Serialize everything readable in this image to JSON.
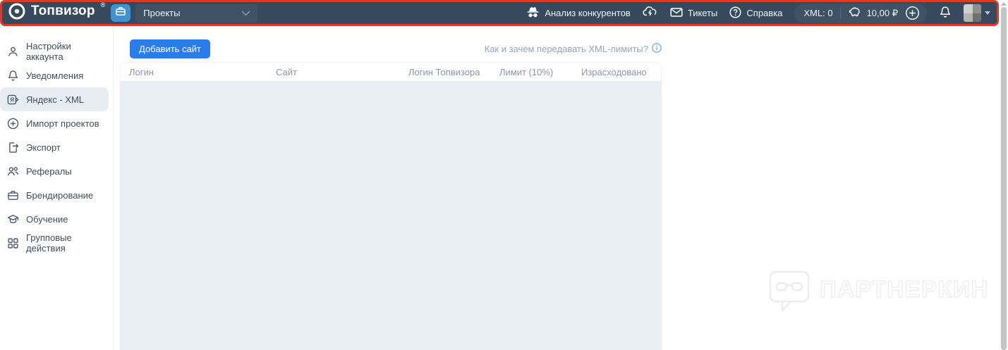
{
  "header": {
    "logo_text": "Топвизор",
    "logo_reg": "®",
    "projects_dropdown": "Проекты",
    "nav": {
      "competitors_label": "Анализ конкурентов",
      "tickets_label": "Тикеты",
      "help_label": "Справка"
    },
    "xml_limit": "XML: 0",
    "balance": "10,00 ₽"
  },
  "sidebar": {
    "items": [
      {
        "label": "Настройки аккаунта",
        "icon": "user-icon",
        "active": false
      },
      {
        "label": "Уведомления",
        "icon": "bell-icon",
        "active": false
      },
      {
        "label": "Яндекс - XML",
        "icon": "yandex-xml-icon",
        "active": true
      },
      {
        "label": "Импорт проектов",
        "icon": "plus-circle-icon",
        "active": false
      },
      {
        "label": "Экспорт",
        "icon": "export-icon",
        "active": false
      },
      {
        "label": "Рефералы",
        "icon": "referrals-icon",
        "active": false
      },
      {
        "label": "Брендирование",
        "icon": "briefcase-icon",
        "active": false
      },
      {
        "label": "Обучение",
        "icon": "graduation-cap-icon",
        "active": false
      },
      {
        "label": "Групповые действия",
        "icon": "grid-icon",
        "active": false
      }
    ]
  },
  "main": {
    "add_site_button": "Добавить сайт",
    "help_link": "Как и зачем передавать XML-лимиты?",
    "table": {
      "columns": [
        "Логин",
        "Сайт",
        "Логин Топвизора",
        "Лимит (10%)",
        "Израсходовано"
      ],
      "rows": []
    }
  },
  "watermark": "ПАРТНЕРКИН",
  "colors": {
    "topbar_bg": "#36495d",
    "annotation_red": "#dc3a28",
    "primary_button": "#2b7ce9",
    "briefcase_button": "#3e93d0",
    "active_item_bg": "#e8edf3",
    "table_body_bg": "#e9eef5",
    "muted_link": "#93a5b8",
    "info_icon": "#56a5e8"
  }
}
